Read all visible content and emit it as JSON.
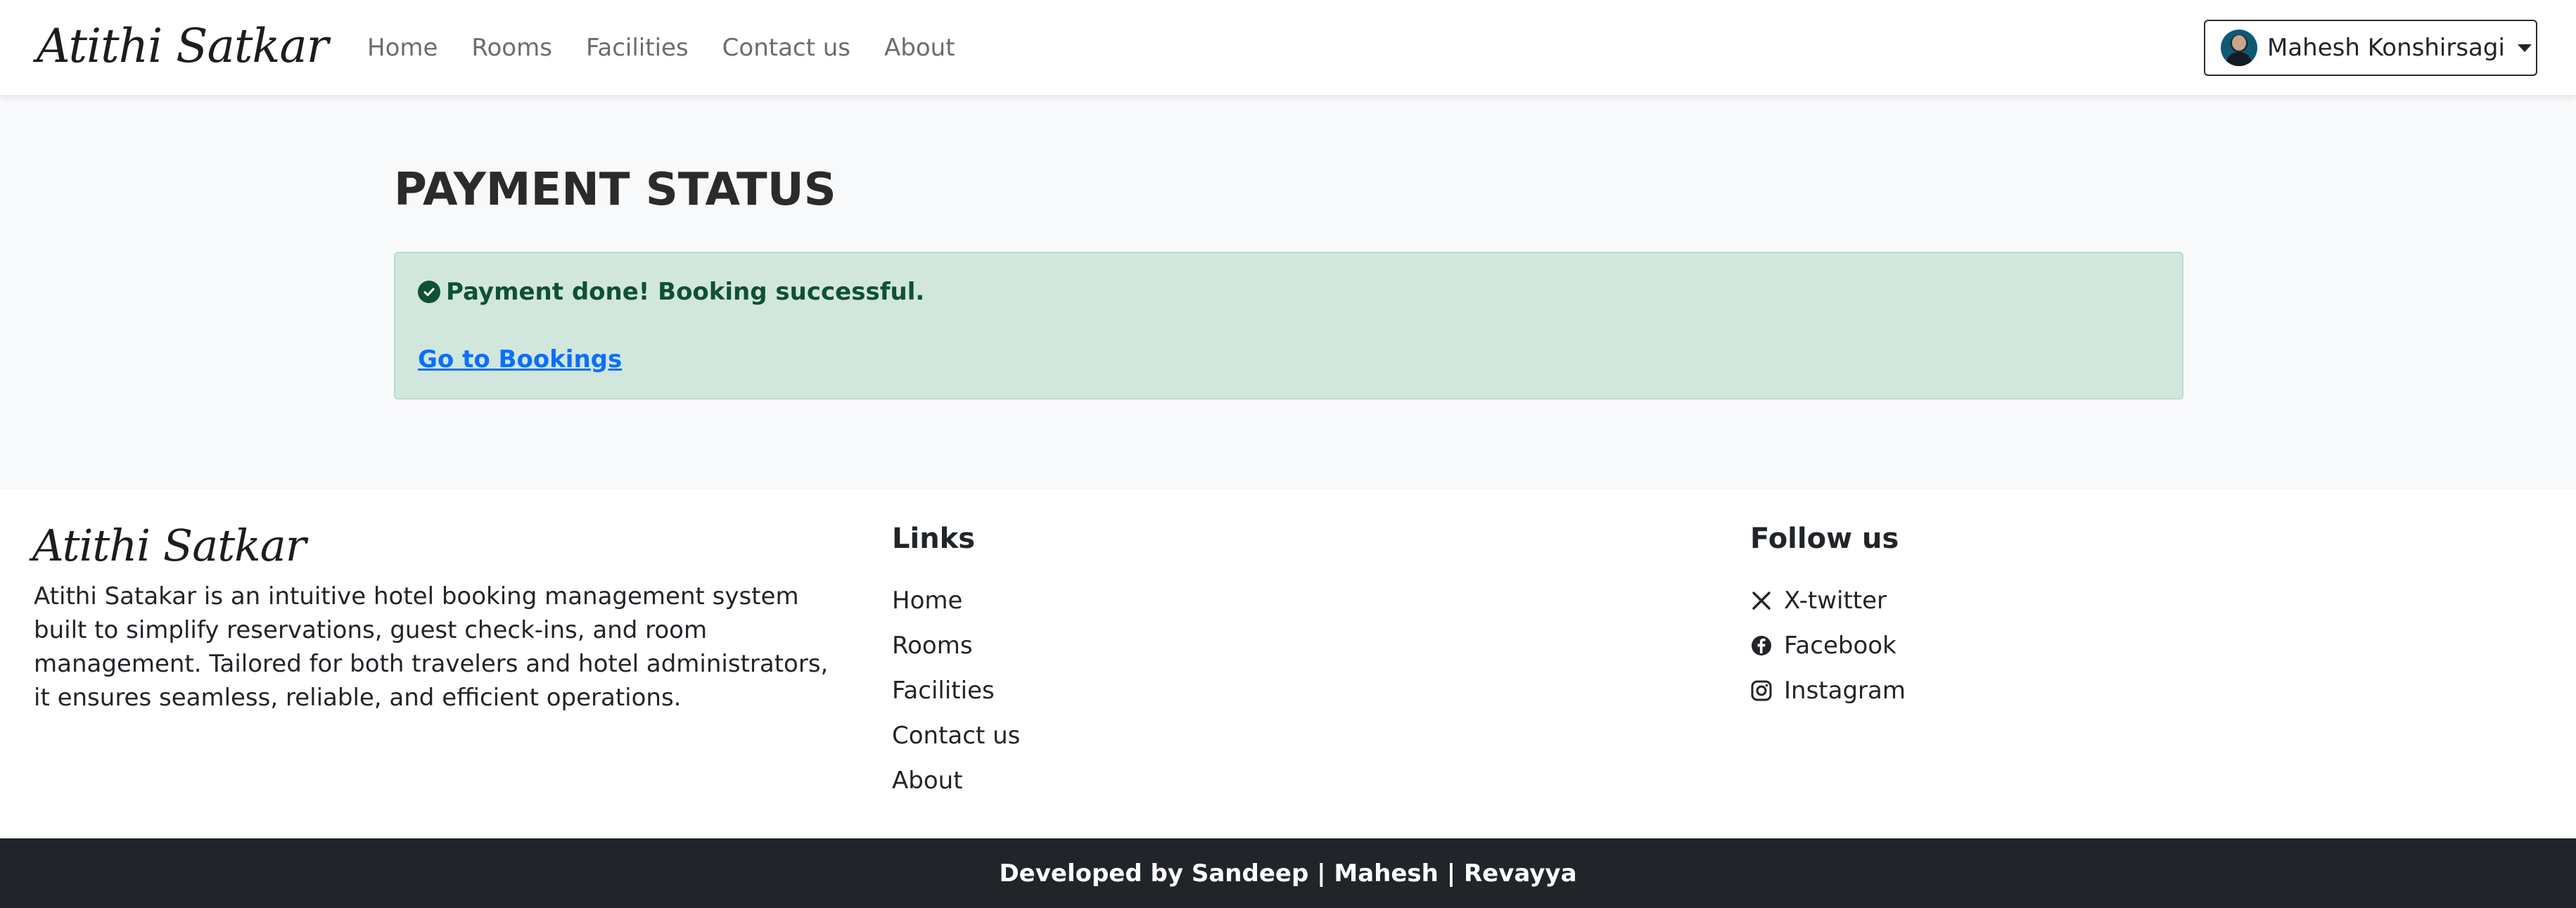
{
  "navbar": {
    "brand": "Atithi Satkar",
    "links": [
      "Home",
      "Rooms",
      "Facilities",
      "Contact us",
      "About"
    ],
    "user": {
      "name": "Mahesh Konshirsagi",
      "avatar_icon": "user-avatar",
      "dropdown_icon": "caret-down-icon"
    }
  },
  "main": {
    "title": "PAYMENT STATUS",
    "alert": {
      "icon": "check-circle-icon",
      "message": "Payment done! Booking successful.",
      "link_label": "Go to Bookings",
      "background_color": "#d1e7dd",
      "text_color": "#0f5132",
      "link_color": "#0d6efd"
    }
  },
  "footer": {
    "brand": "Atithi Satkar",
    "description": "Atithi Satakar is an intuitive hotel booking management system built to simplify reservations, guest check-ins, and room management. Tailored for both travelers and hotel administrators, it ensures seamless, reliable, and efficient operations.",
    "links_heading": "Links",
    "links": [
      "Home",
      "Rooms",
      "Facilities",
      "Contact us",
      "About"
    ],
    "follow_heading": "Follow us",
    "social": [
      {
        "label": "X-twitter",
        "icon": "x-twitter-icon"
      },
      {
        "label": "Facebook",
        "icon": "facebook-icon"
      },
      {
        "label": "Instagram",
        "icon": "instagram-icon"
      }
    ],
    "credits": "Developed by Sandeep | Mahesh | Revayya",
    "bottom_bar_color": "#212529"
  }
}
